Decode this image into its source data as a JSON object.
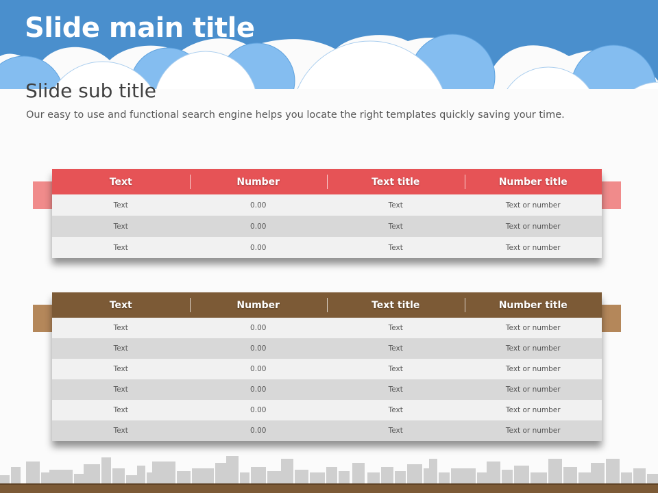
{
  "slide": {
    "title": "Slide main title",
    "subtitle": "Slide sub title",
    "description": "Our easy to use and functional  search engine helps you locate the right templates quickly  saving your time."
  },
  "colors": {
    "sky": "#4a8fcd",
    "cloud_light": "#84bdf0",
    "table1_header": "#e65356",
    "table1_ribbon": "#f08b8b",
    "table2_header": "#7c5a36",
    "table2_ribbon": "#b4875a"
  },
  "tables": [
    {
      "headers": [
        "Text",
        "Number",
        "Text title",
        "Number title"
      ],
      "rows": [
        [
          "Text",
          "0.00",
          "Text",
          "Text or number"
        ],
        [
          "Text",
          "0.00",
          "Text",
          "Text or number"
        ],
        [
          "Text",
          "0.00",
          "Text",
          "Text or number"
        ]
      ]
    },
    {
      "headers": [
        "Text",
        "Number",
        "Text title",
        "Number title"
      ],
      "rows": [
        [
          "Text",
          "0.00",
          "Text",
          "Text or number"
        ],
        [
          "Text",
          "0.00",
          "Text",
          "Text or number"
        ],
        [
          "Text",
          "0.00",
          "Text",
          "Text or number"
        ],
        [
          "Text",
          "0.00",
          "Text",
          "Text or number"
        ],
        [
          "Text",
          "0.00",
          "Text",
          "Text or number"
        ],
        [
          "Text",
          "0.00",
          "Text",
          "Text or number"
        ]
      ]
    }
  ]
}
